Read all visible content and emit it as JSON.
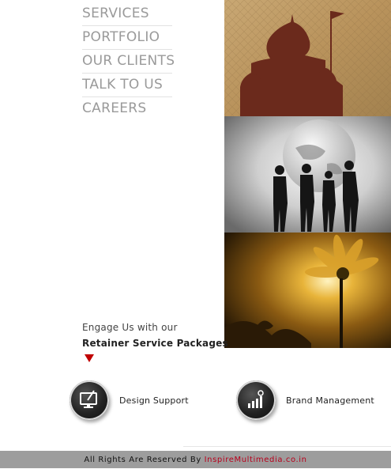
{
  "nav": {
    "items": [
      {
        "label": "SERVICES"
      },
      {
        "label": "PORTFOLIO"
      },
      {
        "label": "OUR CLIENTS"
      },
      {
        "label": "TALK TO US"
      },
      {
        "label": "CAREERS"
      }
    ]
  },
  "promo": {
    "line1": "Engage Us with our",
    "line2": "Retainer Service Packages"
  },
  "services": [
    {
      "label": "Design Support",
      "icon": "design-monitor-icon"
    },
    {
      "label": "Brand Management",
      "icon": "brand-growth-icon"
    }
  ],
  "footer": {
    "text": "All Rights Are Reserved By",
    "link": "InspireMultimedia.co.in"
  },
  "colors": {
    "accent": "#c00000",
    "nav_text": "#9a9a9a",
    "footer_bg": "#9d9d9d"
  }
}
